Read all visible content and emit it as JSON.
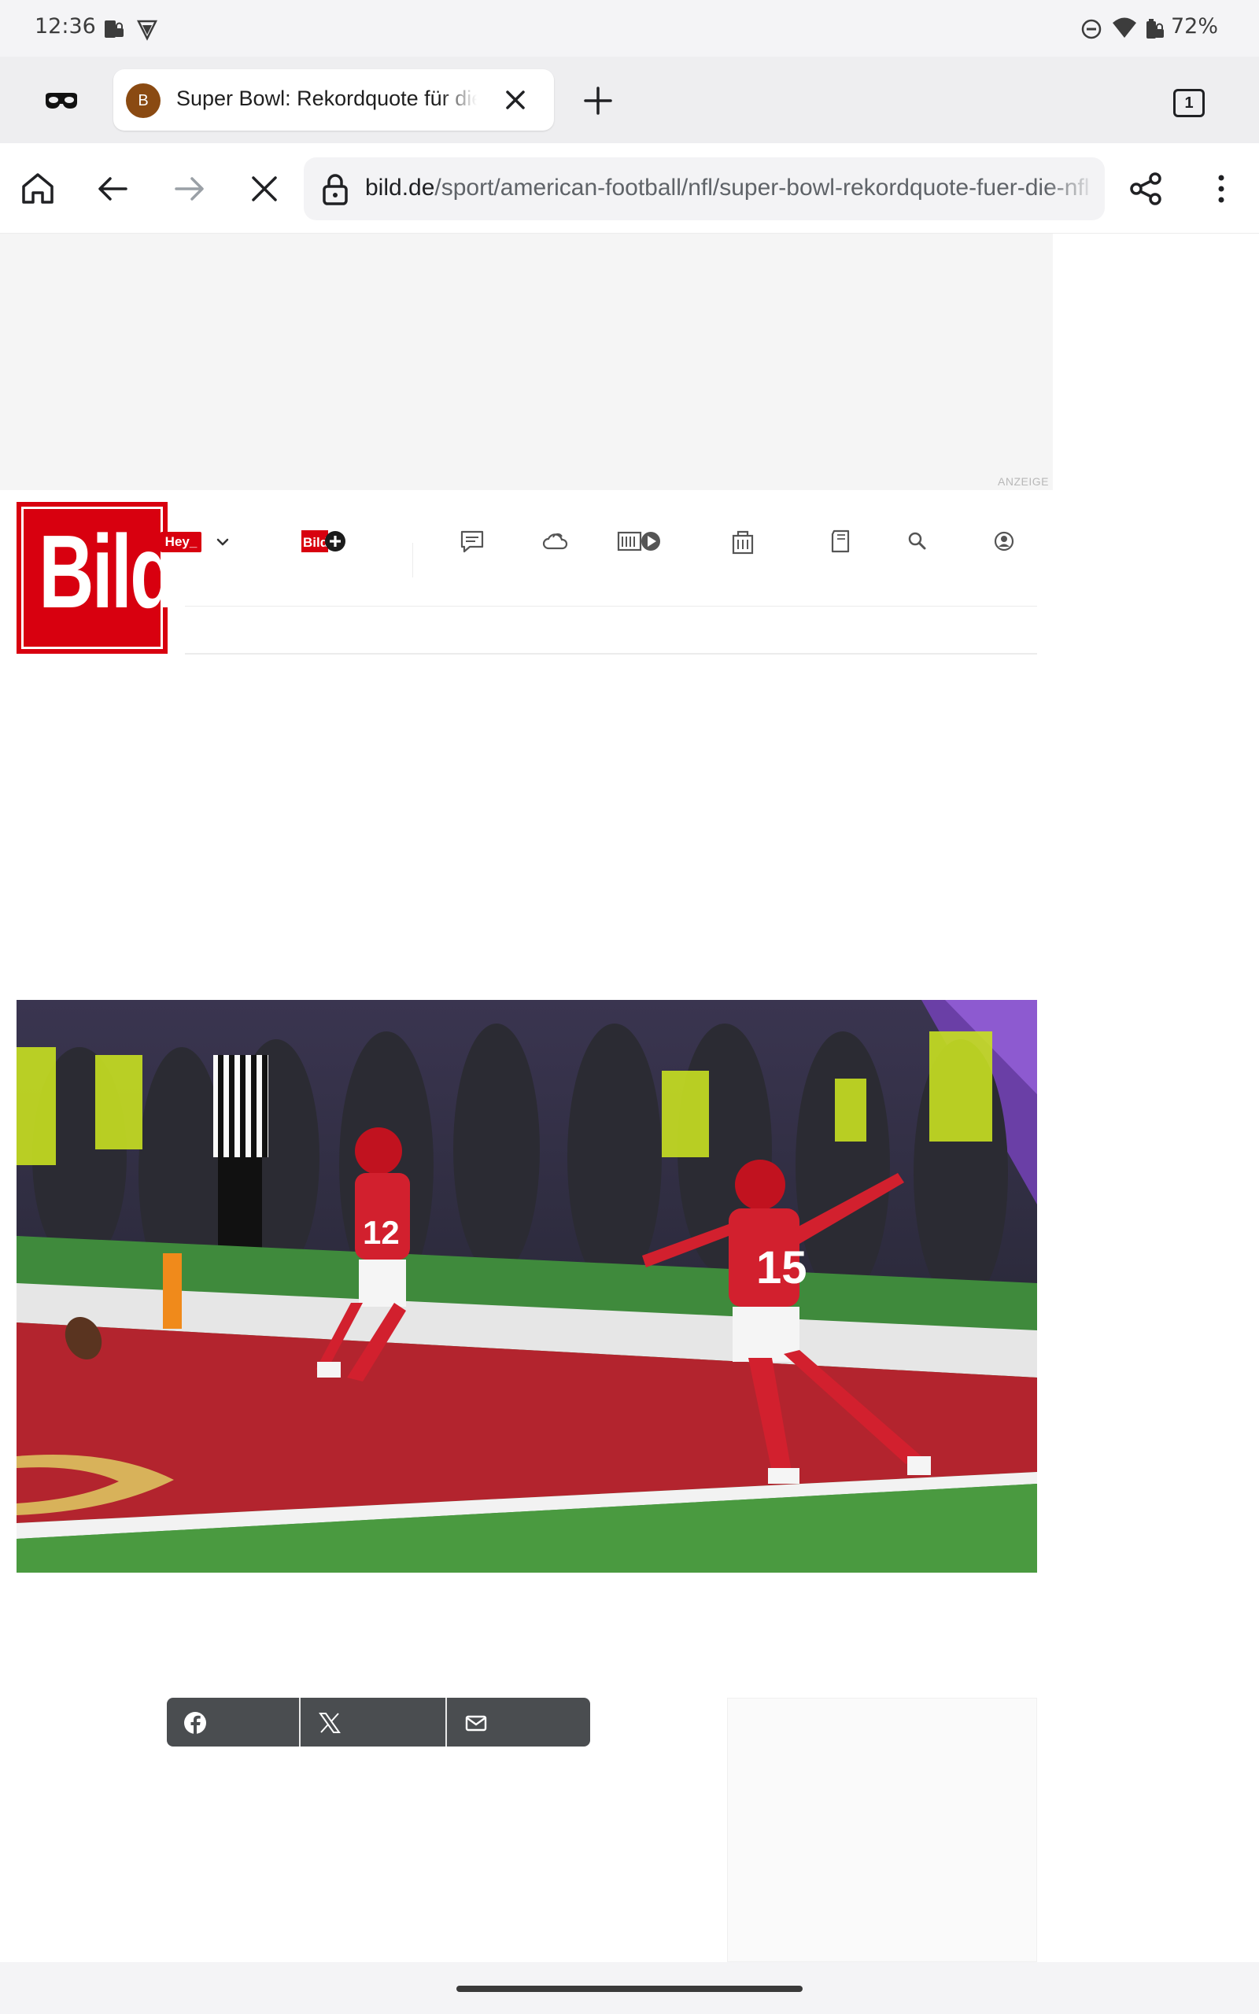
{
  "status_bar": {
    "time": "12:36",
    "battery": "72%",
    "icons_left": [
      "cast-lock-icon",
      "shield-icon"
    ],
    "icons_right": [
      "do-not-disturb-icon",
      "wifi-icon",
      "battery-icon"
    ]
  },
  "tab_strip": {
    "favicon_letter": "B",
    "tab_title": "Super Bowl: Rekordquote für die NFL",
    "tab_count": "1"
  },
  "toolbar": {
    "url_domain": "bild.de",
    "url_path": "/sport/american-football/nfl/super-bowl-rekordquote-fuer-die-nfl"
  },
  "page": {
    "ad_label": "ANZEIGE",
    "logo_text": "Bild",
    "hey_label": "Hey_",
    "nav_icons": [
      "bild-plus-icon",
      "comments-icon",
      "weather-icon",
      "bild-tv-icon",
      "shopping-bag-icon",
      "epaper-icon",
      "search-icon",
      "account-icon"
    ],
    "hero_description": "",
    "share_buttons": [
      "facebook-icon",
      "x-icon",
      "mail-icon"
    ]
  },
  "colors": {
    "bild_red": "#d8000f",
    "share_bar": "#4a4d50",
    "ad_background": "#f5f5f5"
  }
}
